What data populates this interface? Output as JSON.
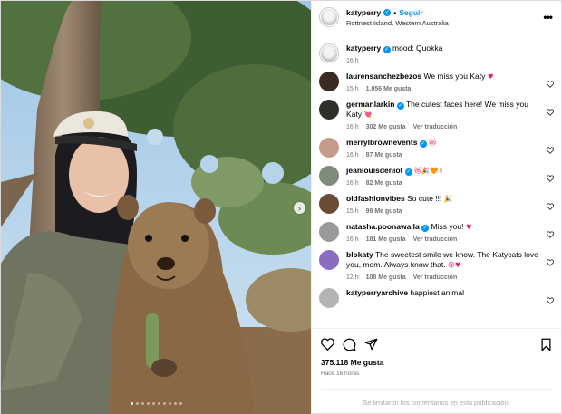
{
  "post": {
    "image": {
      "description_icon": "photo",
      "current_slide": 1,
      "total_slides": 10
    },
    "next_label": "›"
  },
  "header": {
    "username": "katyperry",
    "separator": "•",
    "follow_label": "Seguir",
    "location": "Rottnest Island, Western Australia",
    "more_label": "•••"
  },
  "caption": {
    "username": "katyperry",
    "text": "mood: Quokka",
    "time": "16 h"
  },
  "comments": [
    {
      "username": "laurensanchezbezos",
      "verified": false,
      "text": "We miss you Katy",
      "emoji": "♥",
      "time": "15 h",
      "likes": "1.056 Me gusta",
      "translate": "",
      "av_color": "#3a2a22"
    },
    {
      "username": "germanlarkin",
      "verified": true,
      "text": "The cutest faces here! We miss you Katy",
      "emoji": "💘",
      "time": "16 h",
      "likes": "302 Me gusta",
      "translate": "Ver traducción",
      "av_color": "#2d2f2b"
    },
    {
      "username": "merrylbrownevents",
      "verified": true,
      "text": "",
      "emoji": "😻",
      "time": "16 h",
      "likes": "87 Me gusta",
      "translate": "",
      "av_color": "#c89a8c"
    },
    {
      "username": "jeanlouisdeniot",
      "verified": true,
      "text": "",
      "emoji": "😻🎉🧡✌",
      "time": "16 h",
      "likes": "82 Me gusta",
      "translate": "",
      "av_color": "#7e8a7a"
    },
    {
      "username": "oldfashionvibes",
      "verified": false,
      "text": "So cute !!!",
      "emoji": "🎉",
      "time": "15 h",
      "likes": "99 Me gusta",
      "translate": "",
      "av_color": "#6a4b33"
    },
    {
      "username": "natasha.poonawalla",
      "verified": true,
      "text": "Miss you!",
      "emoji": "♥",
      "time": "16 h",
      "likes": "181 Me gusta",
      "translate": "Ver traducción",
      "av_color": "#9a9a9a"
    },
    {
      "username": "blokaty",
      "verified": false,
      "text": "The sweetest smile we know. The Katycats love you, mom. Always know that.",
      "emoji": "😝♥",
      "time": "12 h",
      "likes": "108 Me gusta",
      "translate": "Ver traducción",
      "av_color": "#8a6cc0"
    },
    {
      "username": "katyperryarchive",
      "verified": false,
      "text": "happiest animal",
      "emoji": "",
      "time": "",
      "likes": "",
      "translate": "",
      "av_color": "#b4b4b4"
    }
  ],
  "actions": {
    "likes": "375.118 Me gusta",
    "time_ago": "Hace 16 horas",
    "comments_limited": "Se limitaron los comentarios en esta publicación."
  },
  "colors": {
    "accent": "#0095f6",
    "heart": "#e0245e",
    "muted": "#737373"
  }
}
